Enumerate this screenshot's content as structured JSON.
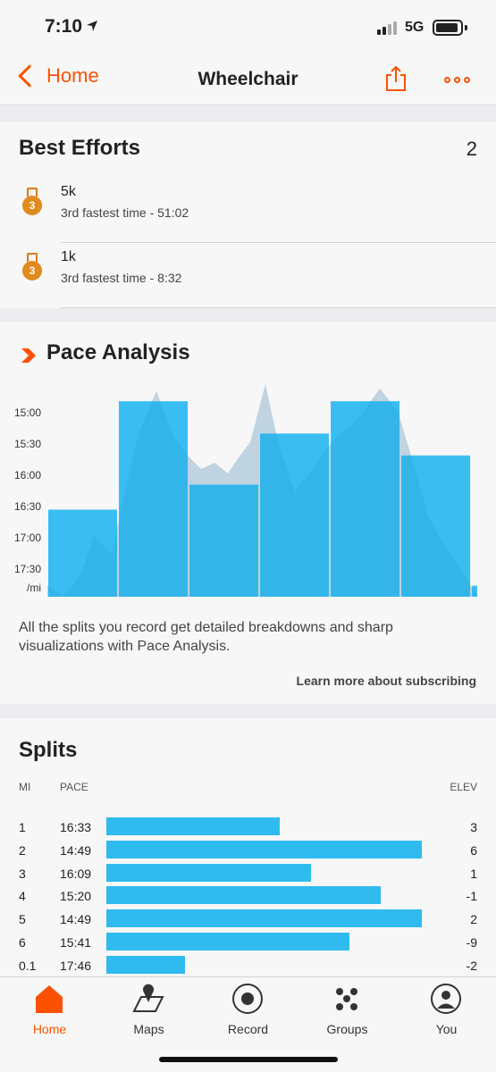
{
  "status_bar": {
    "time": "7:10",
    "location_arrow": "location-arrow-icon",
    "network": "5G"
  },
  "nav": {
    "back_label": "Home",
    "title": "Wheelchair",
    "share_icon": "share-icon",
    "more_icon": "more-icon"
  },
  "best_efforts": {
    "title": "Best Efforts",
    "count": "2",
    "items": [
      {
        "name": "5k",
        "detail": "3rd fastest time - 51:02",
        "medal": "3"
      },
      {
        "name": "1k",
        "detail": "3rd fastest time - 8:32",
        "medal": "3"
      }
    ]
  },
  "pace_analysis": {
    "title": "Pace Analysis",
    "description": "All the splits you record get detailed breakdowns and sharp visualizations with Pace Analysis.",
    "learn_more": "Learn more about subscribing",
    "accent_color": "#fc5200",
    "bar_color": "#2fbaf0"
  },
  "chart_data": {
    "type": "bar",
    "ylabel": "/mi",
    "y_ticks": [
      "15:00",
      "15:30",
      "16:00",
      "16:30",
      "17:00",
      "17:30"
    ],
    "y_axis": "pace in seconds per mile, inverted (faster = taller)",
    "y_range_seconds": [
      900,
      1080
    ],
    "categories": [
      "1",
      "2",
      "3",
      "4",
      "5",
      "6",
      "0.1"
    ],
    "values_seconds": [
      993,
      889,
      969,
      920,
      889,
      941,
      1066
    ],
    "values": [
      "16:33",
      "14:49",
      "16:09",
      "15:20",
      "14:49",
      "15:41",
      "17:46"
    ],
    "split_widths_mi": [
      1,
      1,
      1,
      1,
      1,
      1,
      0.1
    ],
    "background_profile": "grey elevation-style area behind bars"
  },
  "splits": {
    "title": "Splits",
    "columns": {
      "mi": "MI",
      "pace": "PACE",
      "elev": "ELEV"
    },
    "rows": [
      {
        "mi": "1",
        "pace": "16:33",
        "elev": "3",
        "fraction": 0.55
      },
      {
        "mi": "2",
        "pace": "14:49",
        "elev": "6",
        "fraction": 1.0
      },
      {
        "mi": "3",
        "pace": "16:09",
        "elev": "1",
        "fraction": 0.65
      },
      {
        "mi": "4",
        "pace": "15:20",
        "elev": "-1",
        "fraction": 0.87
      },
      {
        "mi": "5",
        "pace": "14:49",
        "elev": "2",
        "fraction": 1.0
      },
      {
        "mi": "6",
        "pace": "15:41",
        "elev": "-9",
        "fraction": 0.77
      },
      {
        "mi": "0.1",
        "pace": "17:46",
        "elev": "-2",
        "fraction": 0.25
      }
    ]
  },
  "tabs": [
    {
      "label": "Home",
      "icon": "home-icon",
      "active": true
    },
    {
      "label": "Maps",
      "icon": "map-icon",
      "active": false
    },
    {
      "label": "Record",
      "icon": "record-icon",
      "active": false
    },
    {
      "label": "Groups",
      "icon": "groups-icon",
      "active": false
    },
    {
      "label": "You",
      "icon": "profile-icon",
      "active": false
    }
  ]
}
